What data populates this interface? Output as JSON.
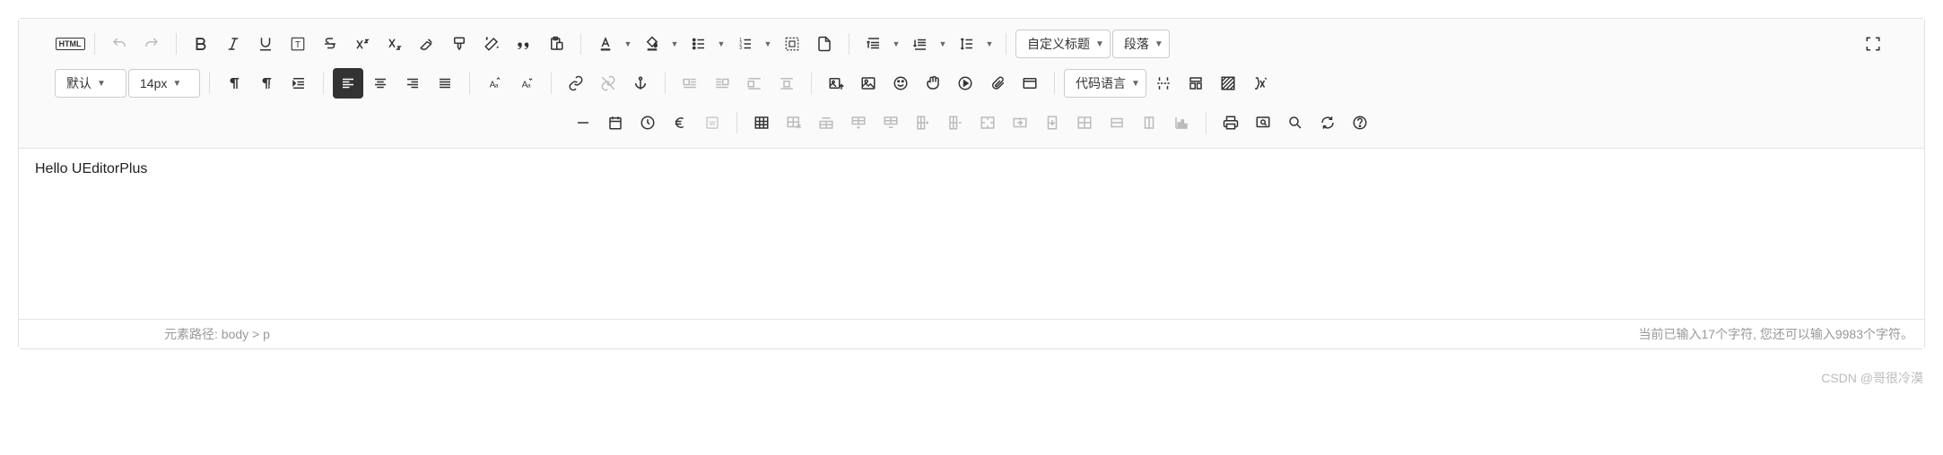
{
  "selects": {
    "heading": "自定义标题",
    "paragraph": "段落",
    "font_family": "默认",
    "font_size": "14px",
    "code_lang": "代码语言"
  },
  "content": "Hello UEditorPlus",
  "status": {
    "path_label": "元素路径:",
    "path_value": "body > p",
    "chars": "当前已输入17个字符, 您还可以输入9983个字符。"
  },
  "watermark": "CSDN @哥很冷漠",
  "html_badge": "HTML"
}
